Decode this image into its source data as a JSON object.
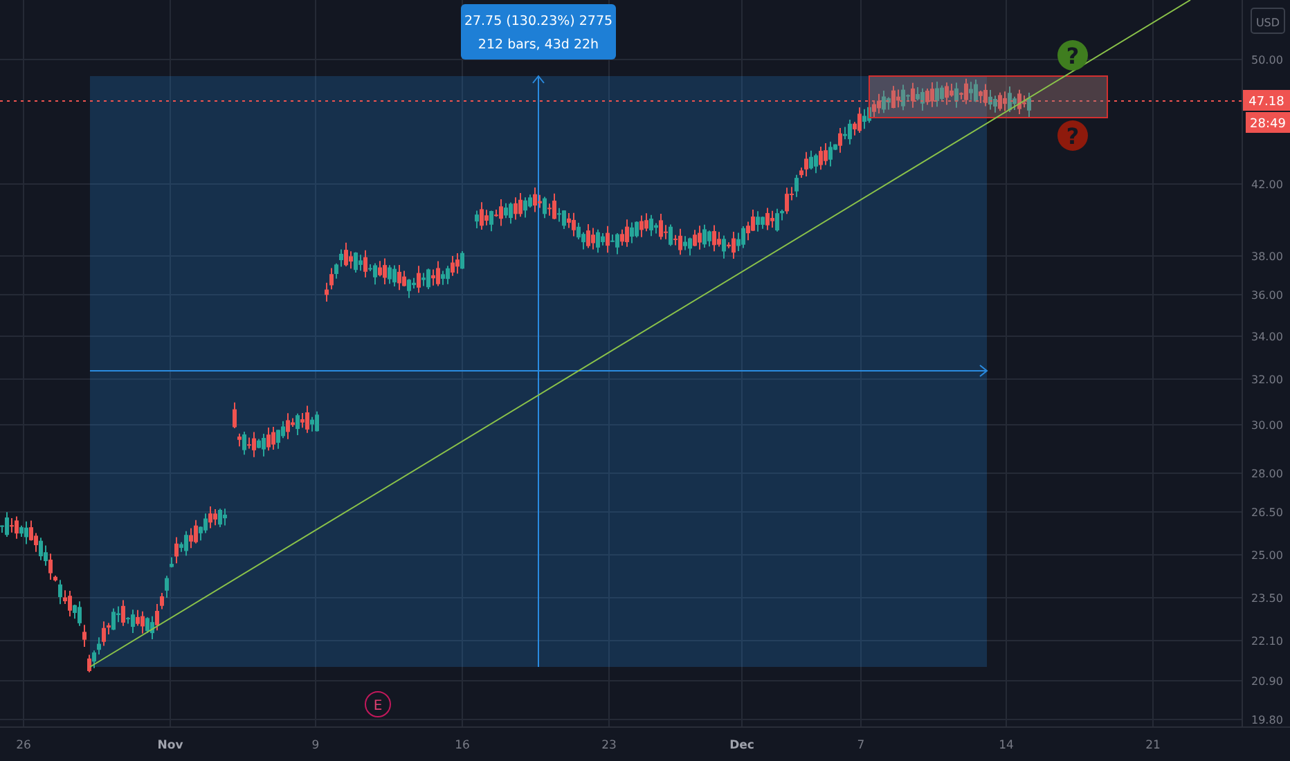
{
  "price_axis": {
    "currency": "USD",
    "ticks": [
      "50.00",
      "42.00",
      "38.00",
      "36.00",
      "34.00",
      "32.00",
      "30.00",
      "28.00",
      "26.50",
      "25.00",
      "23.50",
      "22.10",
      "20.90",
      "19.80"
    ],
    "last_price": "47.18",
    "countdown": "28:49"
  },
  "time_axis": {
    "ticks": [
      {
        "label": "26",
        "major": false
      },
      {
        "label": "Nov",
        "major": true
      },
      {
        "label": "9",
        "major": false
      },
      {
        "label": "16",
        "major": false
      },
      {
        "label": "23",
        "major": false
      },
      {
        "label": "Dec",
        "major": true
      },
      {
        "label": "7",
        "major": false
      },
      {
        "label": "14",
        "major": false
      },
      {
        "label": "21",
        "major": false
      }
    ]
  },
  "measure": {
    "lines": [
      "27.75 (130.23%) 2775",
      "212 bars, 43d 22h"
    ]
  },
  "earnings": {
    "symbol": "E"
  },
  "alerts": [
    {
      "symbol": "?",
      "color": "#3f7d1f"
    },
    {
      "symbol": "?",
      "color": "#8e1a0c"
    }
  ]
}
